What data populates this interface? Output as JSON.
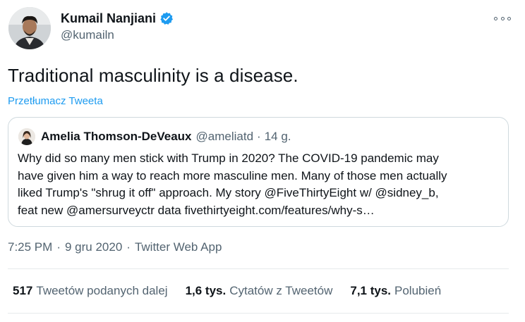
{
  "author": {
    "name": "Kumail Nanjiani",
    "handle": "@kumailn"
  },
  "tweet": {
    "text": "Traditional masculinity is a disease.",
    "translate_label": "Przetłumacz Tweeta"
  },
  "quoted": {
    "name": "Amelia Thomson-DeVeaux",
    "handle": "@ameliatd",
    "dot": "·",
    "time": "14 g.",
    "lines": [
      "Why did so many men stick with Trump in 2020? The COVID-19 pandemic may",
      "have given him a way to reach more masculine men. Many of those men actually",
      "liked Trump's \"shrug it off\" approach. My story @FiveThirtyEight w/ @sidney_b,",
      "feat new @amersurveyctr data fivethirtyeight.com/features/why-s…"
    ]
  },
  "meta": {
    "time": "7:25 PM",
    "dot1": "·",
    "date": "9 gru 2020",
    "dot2": "·",
    "source": "Twitter Web App"
  },
  "stats": [
    {
      "num": "517",
      "label": "Tweetów podanych dalej"
    },
    {
      "num": "1,6 tys.",
      "label": "Cytatów z Tweetów"
    },
    {
      "num": "7,1 tys.",
      "label": "Polubień"
    }
  ],
  "colors": {
    "accent": "#1d9bf0",
    "secondary_text": "#536471",
    "border": "#cfd9de"
  },
  "icons": {
    "verified": "verified-badge-icon",
    "more": "more-options-icon"
  }
}
